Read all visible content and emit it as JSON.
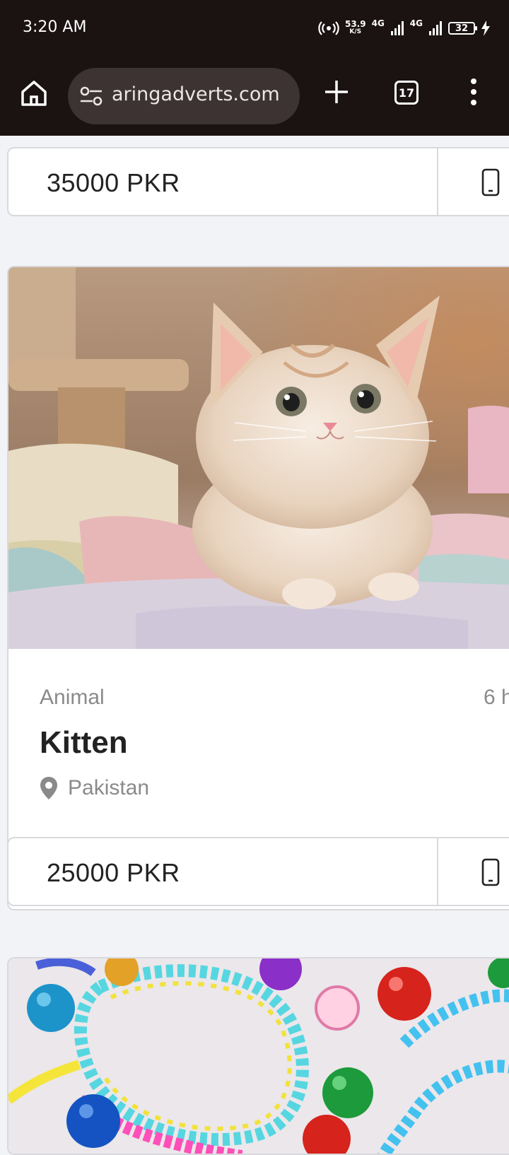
{
  "status_bar": {
    "time": "3:20 AM",
    "speed_value": "53.9",
    "speed_unit": "K/S",
    "net1": "4G",
    "net2": "4G",
    "battery": "32"
  },
  "browser": {
    "url": "aringadverts.com",
    "tab_count": "17"
  },
  "listings": [
    {
      "price": "35000 PKR"
    },
    {
      "category": "Animal",
      "time_ago": "6 h",
      "title": "Kitten",
      "location": "Pakistan",
      "price": "25000 PKR"
    }
  ],
  "icons": {
    "home": "home-icon",
    "site_settings": "tune-icon",
    "new_tab": "plus-icon",
    "menu": "more-vert-icon",
    "contact": "phone-icon",
    "location": "location-pin-icon"
  }
}
